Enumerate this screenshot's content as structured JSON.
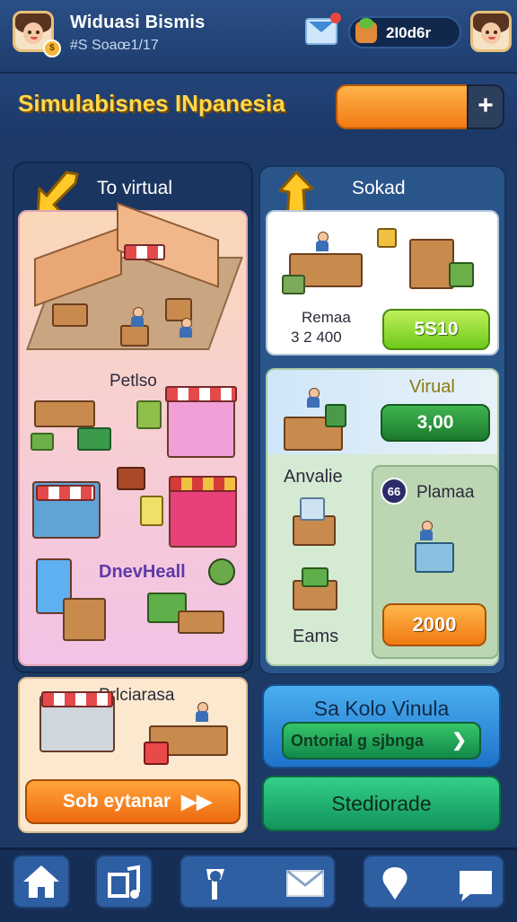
{
  "header": {
    "title": "Widuasi Bismis",
    "subtitle": "#S Soaœ1/17",
    "gems_value": "2I0d6r"
  },
  "banner": {
    "title": "Simulabisnes INpanesia",
    "plus": "+"
  },
  "left_panel": {
    "header": "To virtual",
    "label_mid": "Petlso",
    "label_bottom": "DnevHeall"
  },
  "right_panel": {
    "header": "Sokad",
    "card1": {
      "name": "Remaa",
      "price": "3 2 400",
      "button": "5S10"
    },
    "card2": {
      "title": "Virual",
      "button": "3,00",
      "label": "Anvalie",
      "label2": "Eams"
    },
    "card3": {
      "badge": "66",
      "title": "Plamaa",
      "button": "2000"
    }
  },
  "bottom_left": {
    "title": "Prlciarasa",
    "button": "Sob eytanar"
  },
  "bottom_right": {
    "blue_title": "Sa Kolo Vinula",
    "green_inner": "Ontorial g sjbnga",
    "teal_button": "Stediorade"
  },
  "icons": {
    "mail": "mail-icon",
    "home": "home-icon",
    "music": "music-icon",
    "tools": "tools-icon",
    "envelope": "envelope-icon",
    "location": "location-icon",
    "chat": "chat-icon"
  },
  "colors": {
    "background": "#1d3a66",
    "accent_yellow": "#ffd84a",
    "orange": "#f27a12",
    "green": "#6fc91a"
  }
}
